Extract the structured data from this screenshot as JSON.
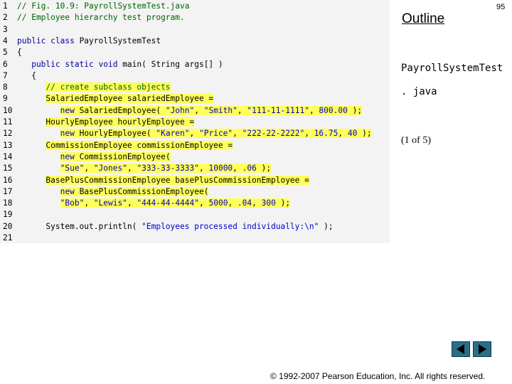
{
  "outline_title": "Outline",
  "page_number": "95",
  "file_name_line1": "PayrollSystemTest",
  "file_name_line2": ". java",
  "slide_counter": "(1 of 5)",
  "copyright": "© 1992-2007 Pearson Education, Inc.  All rights reserved.",
  "nav": {
    "prev_icon": "triangle-left-icon",
    "next_icon": "triangle-right-icon",
    "button_color": "#2a6f87"
  },
  "highlight_color": "#ffff5a",
  "code_lines": [
    {
      "num": "1",
      "segments": [
        {
          "text": "// Fig. 10.9: PayrollSystemTest.java",
          "cls": "cm"
        }
      ]
    },
    {
      "num": "2",
      "segments": [
        {
          "text": "// Employee hierarchy test program.",
          "cls": "cm"
        }
      ]
    },
    {
      "num": "3",
      "segments": []
    },
    {
      "num": "4",
      "segments": [
        {
          "text": "public class ",
          "cls": "kw"
        },
        {
          "text": "PayrollSystemTest",
          "cls": ""
        }
      ]
    },
    {
      "num": "5",
      "segments": [
        {
          "text": "{",
          "cls": ""
        }
      ]
    },
    {
      "num": "6",
      "segments": [
        {
          "text": "   public static void ",
          "cls": "kw"
        },
        {
          "text": "main( String args[] )",
          "cls": ""
        }
      ]
    },
    {
      "num": "7",
      "segments": [
        {
          "text": "   {",
          "cls": ""
        }
      ]
    },
    {
      "num": "8",
      "segments": [
        {
          "text": "      ",
          "cls": ""
        },
        {
          "text": "// create subclass objects",
          "cls": "cm hl"
        }
      ]
    },
    {
      "num": "9",
      "segments": [
        {
          "text": "      ",
          "cls": ""
        },
        {
          "text": "SalariedEmployee salariedEmployee =",
          "cls": "hl"
        }
      ]
    },
    {
      "num": "10",
      "segments": [
        {
          "text": "         ",
          "cls": ""
        },
        {
          "text": "new ",
          "cls": "kw hl"
        },
        {
          "text": "SalariedEmployee( ",
          "cls": "hl"
        },
        {
          "text": "\"John\"",
          "cls": "str hl"
        },
        {
          "text": ", ",
          "cls": "hl"
        },
        {
          "text": "\"Smith\"",
          "cls": "str hl"
        },
        {
          "text": ", ",
          "cls": "hl"
        },
        {
          "text": "\"111-11-1111\"",
          "cls": "str hl"
        },
        {
          "text": ", ",
          "cls": "hl"
        },
        {
          "text": "800.00",
          "cls": "str hl"
        },
        {
          "text": " );",
          "cls": "hl"
        }
      ]
    },
    {
      "num": "11",
      "segments": [
        {
          "text": "      ",
          "cls": ""
        },
        {
          "text": "HourlyEmployee hourlyEmployee =",
          "cls": "hl"
        }
      ]
    },
    {
      "num": "12",
      "segments": [
        {
          "text": "         ",
          "cls": ""
        },
        {
          "text": "new ",
          "cls": "kw hl"
        },
        {
          "text": "HourlyEmployee( ",
          "cls": "hl"
        },
        {
          "text": "\"Karen\"",
          "cls": "str hl"
        },
        {
          "text": ", ",
          "cls": "hl"
        },
        {
          "text": "\"Price\"",
          "cls": "str hl"
        },
        {
          "text": ", ",
          "cls": "hl"
        },
        {
          "text": "\"222-22-2222\"",
          "cls": "str hl"
        },
        {
          "text": ", ",
          "cls": "hl"
        },
        {
          "text": "16.75",
          "cls": "str hl"
        },
        {
          "text": ", ",
          "cls": "hl"
        },
        {
          "text": "40",
          "cls": "str hl"
        },
        {
          "text": " );",
          "cls": "hl"
        }
      ]
    },
    {
      "num": "13",
      "segments": [
        {
          "text": "      ",
          "cls": ""
        },
        {
          "text": "CommissionEmployee commissionEmployee =",
          "cls": "hl"
        }
      ]
    },
    {
      "num": "14",
      "segments": [
        {
          "text": "         ",
          "cls": ""
        },
        {
          "text": "new ",
          "cls": "kw hl"
        },
        {
          "text": "CommissionEmployee(",
          "cls": "hl"
        }
      ]
    },
    {
      "num": "15",
      "segments": [
        {
          "text": "         ",
          "cls": ""
        },
        {
          "text": "\"Sue\"",
          "cls": "str hl"
        },
        {
          "text": ", ",
          "cls": "hl"
        },
        {
          "text": "\"Jones\"",
          "cls": "str hl"
        },
        {
          "text": ", ",
          "cls": "hl"
        },
        {
          "text": "\"333-33-3333\"",
          "cls": "str hl"
        },
        {
          "text": ", ",
          "cls": "hl"
        },
        {
          "text": "10000",
          "cls": "str hl"
        },
        {
          "text": ", ",
          "cls": "hl"
        },
        {
          "text": ".06",
          "cls": "str hl"
        },
        {
          "text": " );",
          "cls": "hl"
        }
      ]
    },
    {
      "num": "16",
      "segments": [
        {
          "text": "      ",
          "cls": ""
        },
        {
          "text": "BasePlusCommissionEmployee basePlusCommissionEmployee =",
          "cls": "hl"
        }
      ]
    },
    {
      "num": "17",
      "segments": [
        {
          "text": "         ",
          "cls": ""
        },
        {
          "text": "new ",
          "cls": "kw hl"
        },
        {
          "text": "BasePlusCommissionEmployee(",
          "cls": "hl"
        }
      ]
    },
    {
      "num": "18",
      "segments": [
        {
          "text": "         ",
          "cls": ""
        },
        {
          "text": "\"Bob\"",
          "cls": "str hl"
        },
        {
          "text": ", ",
          "cls": "hl"
        },
        {
          "text": "\"Lewis\"",
          "cls": "str hl"
        },
        {
          "text": ", ",
          "cls": "hl"
        },
        {
          "text": "\"444-44-4444\"",
          "cls": "str hl"
        },
        {
          "text": ", ",
          "cls": "hl"
        },
        {
          "text": "5000",
          "cls": "str hl"
        },
        {
          "text": ", ",
          "cls": "hl"
        },
        {
          "text": ".04",
          "cls": "str hl"
        },
        {
          "text": ", ",
          "cls": "hl"
        },
        {
          "text": "300",
          "cls": "str hl"
        },
        {
          "text": " );",
          "cls": "hl"
        }
      ]
    },
    {
      "num": "19",
      "segments": []
    },
    {
      "num": "20",
      "segments": [
        {
          "text": "      System.out.println( ",
          "cls": ""
        },
        {
          "text": "\"Employees processed individually:\\n\"",
          "cls": "str"
        },
        {
          "text": " );",
          "cls": ""
        }
      ]
    },
    {
      "num": "21",
      "segments": []
    }
  ]
}
